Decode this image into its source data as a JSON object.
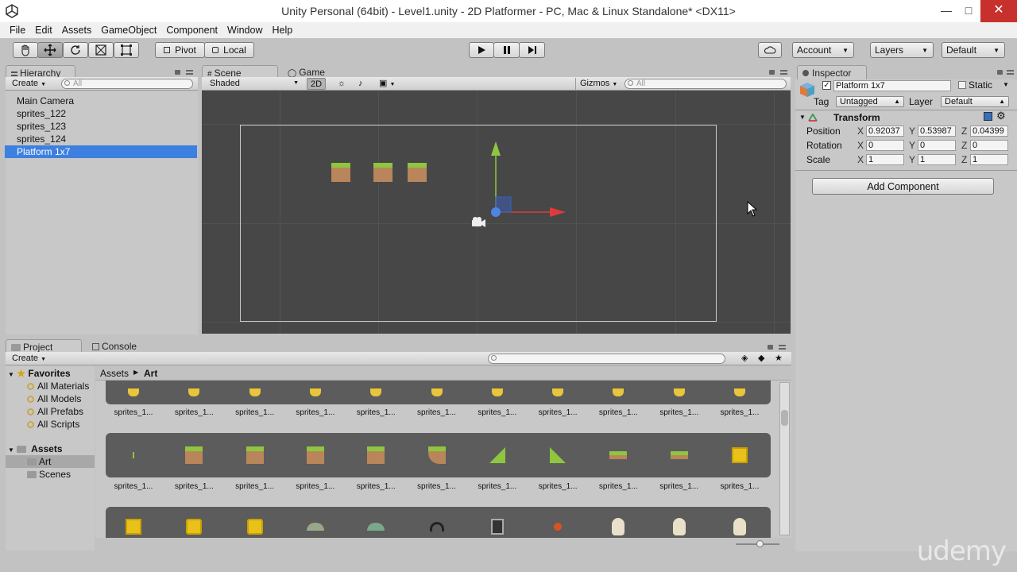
{
  "window": {
    "title": "Unity Personal (64bit) - Level1.unity - 2D Platformer - PC, Mac & Linux Standalone* <DX11>"
  },
  "menu": [
    "File",
    "Edit",
    "Assets",
    "GameObject",
    "Component",
    "Window",
    "Help"
  ],
  "toolbar": {
    "pivot_label": "Pivot",
    "local_label": "Local",
    "account_label": "Account",
    "layers_label": "Layers",
    "layout_label": "Default"
  },
  "hierarchy": {
    "tab_label": "Hierarchy",
    "create_label": "Create",
    "search_placeholder": "All",
    "items": [
      "Main Camera",
      "sprites_122",
      "sprites_123",
      "sprites_124",
      "Platform 1x7"
    ],
    "selected": "Platform 1x7"
  },
  "scene": {
    "scene_tab": "Scene",
    "game_tab": "Game",
    "shading_mode": "Shaded",
    "mode_2d": "2D",
    "gizmos_label": "Gizmos",
    "search_placeholder": "All"
  },
  "inspector": {
    "tab_label": "Inspector",
    "object_name": "Platform 1x7",
    "static_label": "Static",
    "tag_label": "Tag",
    "tag_value": "Untagged",
    "layer_label": "Layer",
    "layer_value": "Default",
    "component_title": "Transform",
    "rows": [
      {
        "label": "Position",
        "x": "0.92037",
        "y": "0.53987",
        "z": "0.04399"
      },
      {
        "label": "Rotation",
        "x": "0",
        "y": "0",
        "z": "0"
      },
      {
        "label": "Scale",
        "x": "1",
        "y": "1",
        "z": "1"
      }
    ],
    "axis_x": "X",
    "axis_y": "Y",
    "axis_z": "Z",
    "add_component_label": "Add Component"
  },
  "project": {
    "project_tab": "Project",
    "console_tab": "Console",
    "create_label": "Create",
    "favorites_label": "Favorites",
    "favorites": [
      "All Materials",
      "All Models",
      "All Prefabs",
      "All Scripts"
    ],
    "assets_label": "Assets",
    "asset_folders": [
      "Art",
      "Scenes"
    ],
    "breadcrumb_root": "Assets",
    "breadcrumb_current": "Art",
    "asset_label": "sprites_1..."
  },
  "watermark": "udemy",
  "colors": {
    "selection": "#3d80df",
    "scene_bg": "#474747",
    "grass": "#8ec63f",
    "dirt": "#b9855a",
    "close": "#c7302c"
  }
}
